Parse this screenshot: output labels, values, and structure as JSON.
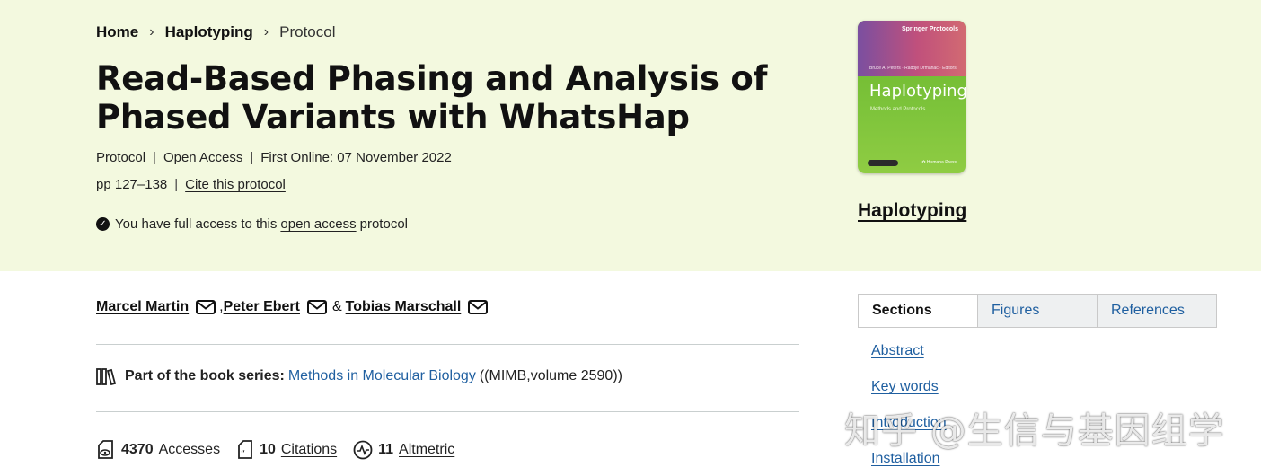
{
  "breadcrumb": {
    "home": "Home",
    "book": "Haplotyping",
    "current": "Protocol",
    "separator": "›"
  },
  "title": "Read-Based Phasing and Analysis of Phased Variants with WhatsHap",
  "meta": {
    "type": "Protocol",
    "access": "Open Access",
    "first_online": "First Online: 07 November 2022",
    "pages": "pp 127–138",
    "cite": "Cite this protocol",
    "divider": "|"
  },
  "access_notice": {
    "prefix": "You have full access to this",
    "link": "open access",
    "suffix": "protocol"
  },
  "book": {
    "title": "Haplotyping",
    "cover": {
      "series": "Springer Protocols",
      "editors": "Bruce A. Peters · Radoje Drmanac · Editors",
      "title": "Haplotyping",
      "subtitle": "Methods and Protocols",
      "publisher": "✿ Humana Press"
    }
  },
  "authors": [
    {
      "name": "Marcel Martin"
    },
    {
      "name": "Peter Ebert"
    },
    {
      "name": "Tobias Marschall"
    }
  ],
  "author_separators": {
    "comma": ",",
    "amp": "&"
  },
  "series": {
    "label": "Part of the book series:",
    "link": "Methods in Molecular Biology",
    "suffix": "((MIMB,volume 2590))"
  },
  "metrics": {
    "accesses": {
      "value": "4370",
      "label": "Accesses"
    },
    "citations": {
      "value": "10",
      "label": "Citations"
    },
    "altmetric": {
      "value": "11",
      "label": "Altmetric"
    }
  },
  "tabs": [
    "Sections",
    "Figures",
    "References"
  ],
  "sections": [
    "Abstract",
    "Key words",
    "Introduction",
    "Installation"
  ],
  "watermark": "知乎 @生信与基因组学",
  "colors": {
    "hero_bg": "#f3f9df",
    "link_blue": "#1f5fa0",
    "text": "#222222"
  },
  "icons": [
    "chevron-right-icon",
    "check-circle-icon",
    "mail-icon",
    "books-icon",
    "download-icon",
    "citation-icon",
    "altmetric-icon"
  ]
}
